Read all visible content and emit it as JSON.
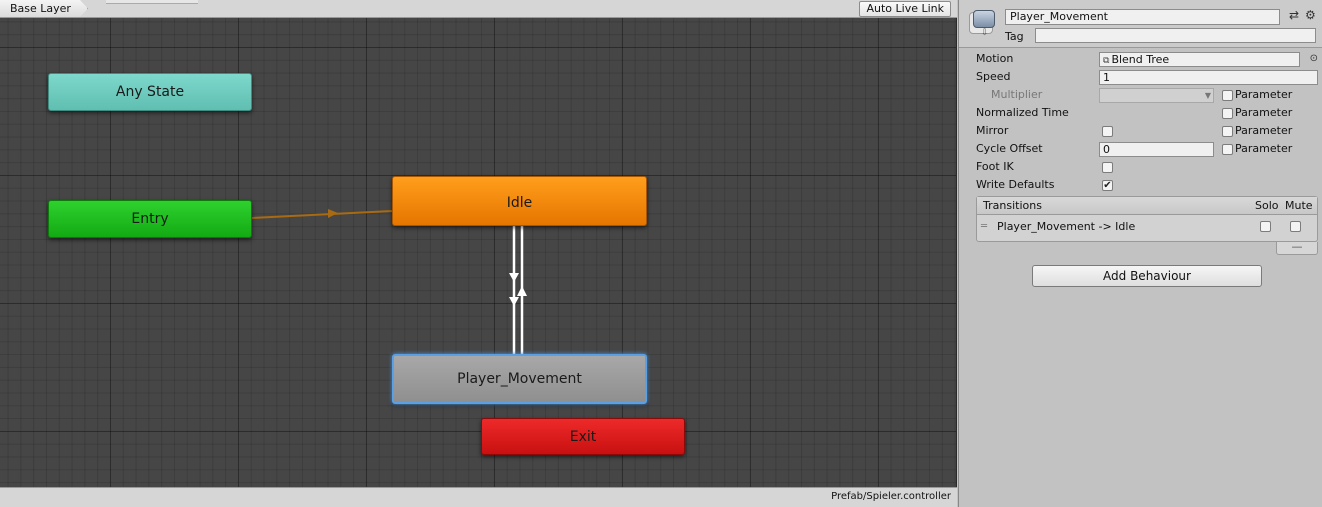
{
  "graph": {
    "breadcrumb": "Base Layer",
    "live_link_label": "Auto Live Link",
    "status_path": "Prefab/Spieler.controller",
    "states": {
      "any": "Any State",
      "entry": "Entry",
      "idle": "Idle",
      "player": "Player_Movement",
      "exit": "Exit"
    },
    "colors": {
      "any_state": "#6fcbbd",
      "entry": "#1fbe1f",
      "idle": "#f08a0d",
      "player_movement": "#9c9c9c",
      "exit": "#dd1d1d",
      "default_transition": "#a86a12",
      "selection": "#5aa0e6"
    }
  },
  "inspector": {
    "state_name": "Player_Movement",
    "tag_label": "Tag",
    "tag_value": "",
    "icons": [
      "state-icon",
      "sliders-icon",
      "gear-icon",
      "target-icon",
      "blend-tree-icon"
    ],
    "properties": {
      "motion_label": "Motion",
      "motion_value": "Blend Tree",
      "speed_label": "Speed",
      "speed_value": "1",
      "multiplier_label": "Multiplier",
      "normalized_time_label": "Normalized Time",
      "mirror_label": "Mirror",
      "cycle_offset_label": "Cycle Offset",
      "cycle_offset_value": "0",
      "foot_ik_label": "Foot IK",
      "write_defaults_label": "Write Defaults",
      "parameter_label": "Parameter",
      "write_defaults_checked": true,
      "mirror_checked": false,
      "foot_ik_checked": false
    },
    "transitions": {
      "title": "Transitions",
      "solo_label": "Solo",
      "mute_label": "Mute",
      "items": [
        {
          "name": "Player_Movement -> Idle",
          "solo": false,
          "mute": false
        }
      ],
      "remove_label": "—"
    },
    "add_behaviour_label": "Add Behaviour"
  }
}
